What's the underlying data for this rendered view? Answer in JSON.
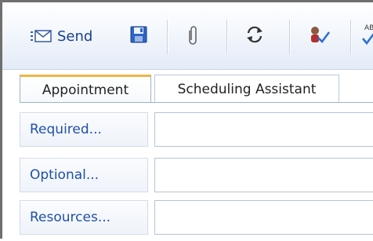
{
  "toolbar": {
    "send_label": "Send",
    "buttons": [
      {
        "icon": "send-icon"
      },
      {
        "icon": "save-icon"
      },
      {
        "icon": "attach-icon"
      },
      {
        "icon": "recurrence-icon"
      },
      {
        "icon": "check-names-icon"
      },
      {
        "icon": "spelling-icon",
        "glyph": "AB"
      }
    ]
  },
  "tabs": [
    {
      "label": "Appointment",
      "active": true
    },
    {
      "label": "Scheduling Assistant",
      "active": false
    }
  ],
  "form": {
    "rows": [
      {
        "label": "Required...",
        "value": ""
      },
      {
        "label": "Optional...",
        "value": ""
      },
      {
        "label": "Resources...",
        "value": ""
      }
    ]
  },
  "colors": {
    "link_blue": "#1f4fa8",
    "active_tab_accent": "#e9b843",
    "toolbar_bg": "#e3ebf7"
  }
}
